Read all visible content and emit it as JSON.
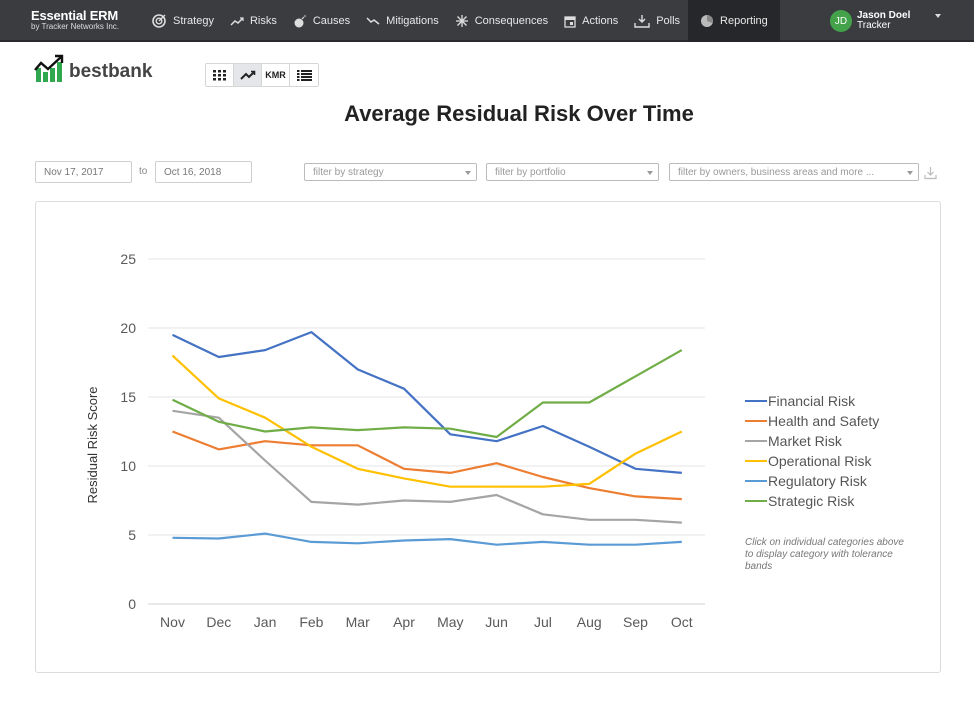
{
  "app": {
    "title": "Essential ERM",
    "subtitle": "by Tracker Networks Inc."
  },
  "nav": [
    {
      "label": "Strategy",
      "icon": "target-icon"
    },
    {
      "label": "Risks",
      "icon": "trend-up-icon"
    },
    {
      "label": "Causes",
      "icon": "bomb-icon"
    },
    {
      "label": "Mitigations",
      "icon": "trend-down-icon"
    },
    {
      "label": "Consequences",
      "icon": "burst-icon"
    },
    {
      "label": "Actions",
      "icon": "calendar-icon"
    },
    {
      "label": "Polls",
      "icon": "inbox-download-icon"
    },
    {
      "label": "Reporting",
      "icon": "pie-chart-icon",
      "active": true
    }
  ],
  "user": {
    "initials": "JD",
    "name": "Jason Doel",
    "role": "Tracker",
    "avatar_color": "#43a24a"
  },
  "org": {
    "name": "bestbank"
  },
  "view_tabs": [
    {
      "name": "grid-view",
      "label": ""
    },
    {
      "name": "trend-view",
      "label": "",
      "active": true
    },
    {
      "name": "kmr-view",
      "label": "KMR"
    },
    {
      "name": "list-view",
      "label": ""
    }
  ],
  "filters": {
    "date_from": "Nov 17, 2017",
    "to_label": "to",
    "date_to": "Oct 16, 2018",
    "strategy_placeholder": "filter by strategy",
    "portfolio_placeholder": "filter by portfolio",
    "owners_placeholder": "filter by owners, business areas and more ..."
  },
  "hint": "Click on individual categories above to display category with tolerance bands",
  "chart_data": {
    "type": "line",
    "title": "Average Residual Risk Over Time",
    "xlabel": "",
    "ylabel": "Residual Risk Score",
    "ylim": [
      0,
      25
    ],
    "yticks": [
      0,
      5,
      10,
      15,
      20,
      25
    ],
    "grid": true,
    "legend": "right",
    "categories": [
      "Nov",
      "Dec",
      "Jan",
      "Feb",
      "Mar",
      "Apr",
      "May",
      "Jun",
      "Jul",
      "Aug",
      "Sep",
      "Oct"
    ],
    "series": [
      {
        "name": "Financial Risk",
        "color": "#4472c4",
        "values": [
          19.5,
          17.9,
          18.4,
          19.7,
          17.0,
          15.6,
          12.3,
          11.8,
          12.9,
          11.4,
          9.8,
          9.5
        ]
      },
      {
        "name": "Health and Safety",
        "color": "#ed7d31",
        "values": [
          12.5,
          11.2,
          11.8,
          11.5,
          11.5,
          9.8,
          9.5,
          10.2,
          9.2,
          8.4,
          7.8,
          7.6
        ]
      },
      {
        "name": "Market Risk",
        "color": "#a5a5a5",
        "values": [
          14.0,
          13.5,
          10.4,
          7.4,
          7.2,
          7.5,
          7.4,
          7.9,
          6.5,
          6.1,
          6.1,
          5.9
        ]
      },
      {
        "name": "Operational Risk",
        "color": "#ffc000",
        "values": [
          18.0,
          14.9,
          13.5,
          11.4,
          9.8,
          9.1,
          8.5,
          8.5,
          8.5,
          8.7,
          10.9,
          12.5
        ]
      },
      {
        "name": "Regulatory Risk",
        "color": "#5b9bd5",
        "values": [
          4.8,
          4.75,
          5.1,
          4.5,
          4.4,
          4.6,
          4.7,
          4.3,
          4.5,
          4.3,
          4.3,
          4.5
        ]
      },
      {
        "name": "Strategic Risk",
        "color": "#70ad47",
        "values": [
          14.8,
          13.2,
          12.5,
          12.8,
          12.6,
          12.8,
          12.7,
          12.1,
          14.6,
          14.6,
          16.5,
          18.4
        ]
      }
    ]
  }
}
